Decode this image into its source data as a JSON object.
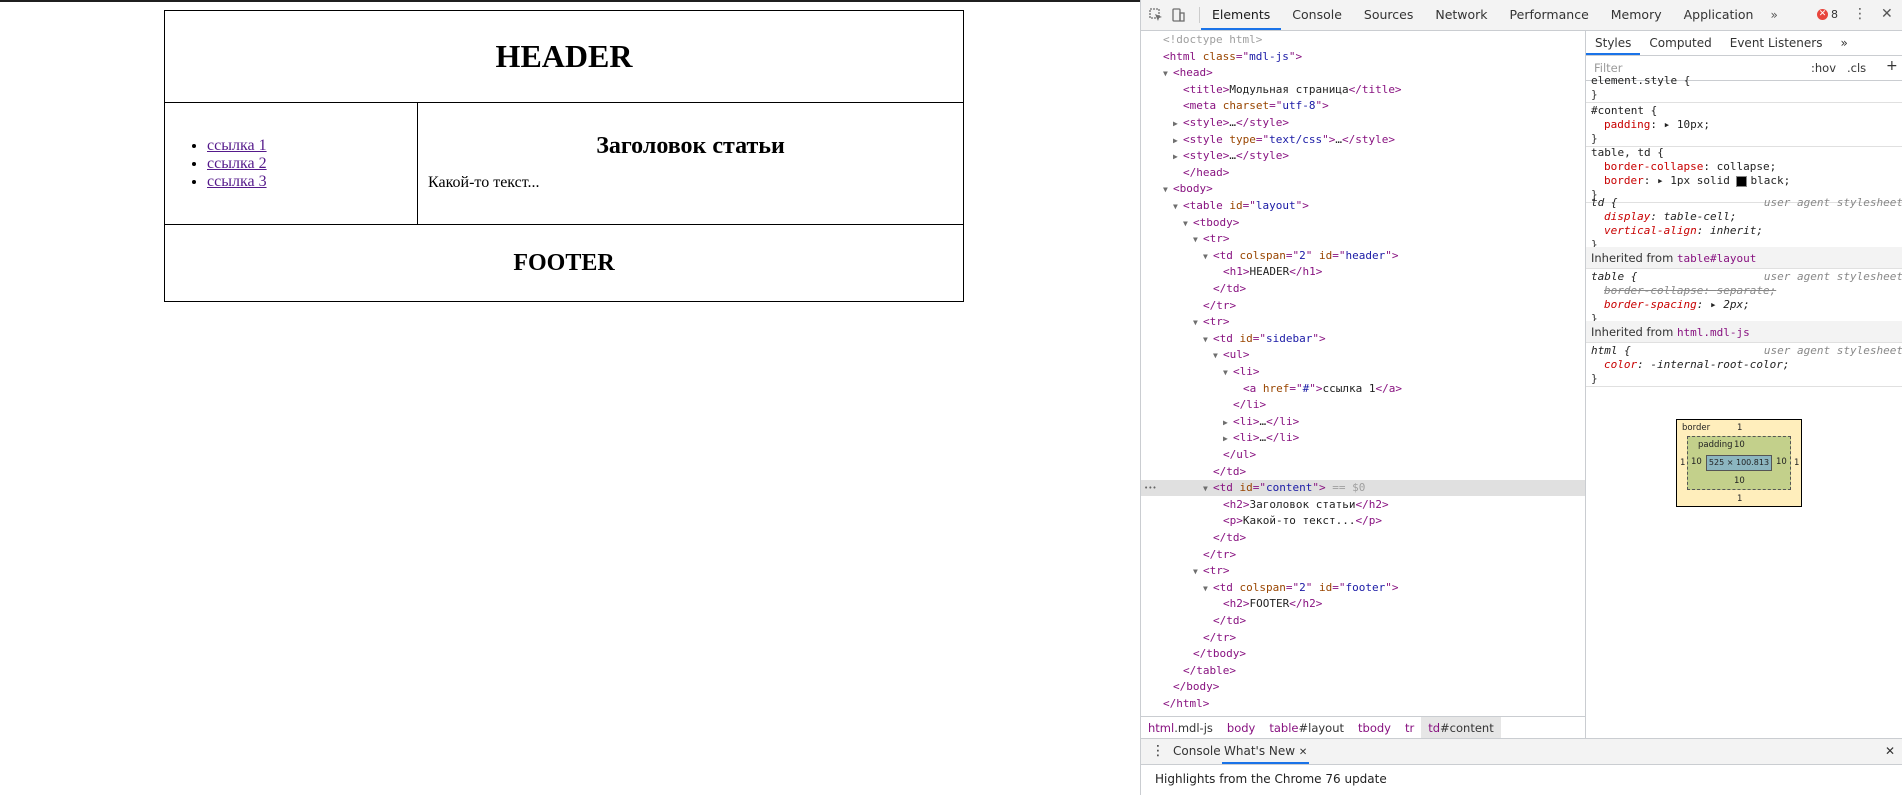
{
  "page": {
    "header": "HEADER",
    "links": [
      "ссылка 1",
      "ссылка 2",
      "ссылка 3"
    ],
    "article_title": "Заголовок статьи",
    "article_text": "Какой-то текст...",
    "footer": "FOOTER"
  },
  "devtools": {
    "tabs": [
      "Elements",
      "Console",
      "Sources",
      "Network",
      "Performance",
      "Memory",
      "Application"
    ],
    "more": "»",
    "error_count": "8",
    "breadcrumbs": [
      {
        "tag": "html",
        "id": ".mdl-js"
      },
      {
        "tag": "body",
        "id": ""
      },
      {
        "tag": "table",
        "id": "#layout"
      },
      {
        "tag": "tbody",
        "id": ""
      },
      {
        "tag": "tr",
        "id": ""
      },
      {
        "tag": "td",
        "id": "#content"
      }
    ],
    "styles_tabs": [
      "Styles",
      "Computed",
      "Event Listeners"
    ],
    "filter_placeholder": "Filter",
    "hov": ":hov",
    "cls": ".cls",
    "rules": {
      "element_style": "element.style {",
      "content_sel": "#content {",
      "content_prop": "padding",
      "content_val": "10px;",
      "table_sel": "table, td {",
      "tp1": "border-collapse",
      "tv1": "collapse;",
      "tp2": "border",
      "tv2": "1px solid ",
      "tv2b": "black;",
      "td_sel": "td {",
      "ua": "user agent stylesheet",
      "tdp1": "display",
      "tdv1": "table-cell;",
      "tdp2": "vertical-align",
      "tdv2": "inherit;",
      "inh1_label": "Inherited from ",
      "inh1_tag": "table#layout",
      "table_ua_sel": "table {",
      "tup1": "border-collapse",
      "tuv1": "separate;",
      "tup2": "border-spacing",
      "tuv2": "2px;",
      "inh2_label": "Inherited from ",
      "inh2_tag": "html.mdl-js",
      "html_sel": "html {",
      "hp1": "color",
      "hv1": "-internal-root-color;",
      "close": "}"
    },
    "box_model": {
      "border_label": "border",
      "border": "1",
      "padding_label": "padding",
      "padding": "10",
      "content": "525 × 100.813"
    },
    "drawer_tabs": [
      "Console",
      "What's New"
    ],
    "drawer_text": "Highlights from the Chrome 76 update",
    "dom_tree": [
      {
        "indent": 0,
        "tri": "",
        "html": "cm",
        "text": "<!doctype html>"
      },
      {
        "indent": 0,
        "tri": "",
        "parts": [
          [
            "tg",
            "<html "
          ],
          [
            "an",
            "class"
          ],
          [
            "tg",
            "=\""
          ],
          [
            "av",
            "mdl-js"
          ],
          [
            "tg",
            "\">"
          ]
        ]
      },
      {
        "indent": 1,
        "tri": "▼",
        "parts": [
          [
            "tg",
            "<head>"
          ]
        ]
      },
      {
        "indent": 2,
        "tri": "",
        "parts": [
          [
            "tg",
            "<title>"
          ],
          [
            "tx",
            "Модульная страница"
          ],
          [
            "tg",
            "</title>"
          ]
        ]
      },
      {
        "indent": 2,
        "tri": "",
        "parts": [
          [
            "tg",
            "<meta "
          ],
          [
            "an",
            "charset"
          ],
          [
            "tg",
            "=\""
          ],
          [
            "av",
            "utf-8"
          ],
          [
            "tg",
            "\">"
          ]
        ]
      },
      {
        "indent": 2,
        "tri": "▶",
        "parts": [
          [
            "tg",
            "<style>"
          ],
          [
            "tx",
            "…"
          ],
          [
            "tg",
            "</style>"
          ]
        ]
      },
      {
        "indent": 2,
        "tri": "▶",
        "parts": [
          [
            "tg",
            "<style "
          ],
          [
            "an",
            "type"
          ],
          [
            "tg",
            "=\""
          ],
          [
            "av",
            "text/css"
          ],
          [
            "tg",
            "\">"
          ],
          [
            "tx",
            "…"
          ],
          [
            "tg",
            "</style>"
          ]
        ]
      },
      {
        "indent": 2,
        "tri": "▶",
        "parts": [
          [
            "tg",
            "<style>"
          ],
          [
            "tx",
            "…"
          ],
          [
            "tg",
            "</style>"
          ]
        ]
      },
      {
        "indent": 2,
        "tri": "",
        "parts": [
          [
            "tg",
            "</head>"
          ]
        ]
      },
      {
        "indent": 1,
        "tri": "▼",
        "parts": [
          [
            "tg",
            "<body>"
          ]
        ]
      },
      {
        "indent": 2,
        "tri": "▼",
        "parts": [
          [
            "tg",
            "<table "
          ],
          [
            "an",
            "id"
          ],
          [
            "tg",
            "=\""
          ],
          [
            "av",
            "layout"
          ],
          [
            "tg",
            "\">"
          ]
        ]
      },
      {
        "indent": 3,
        "tri": "▼",
        "parts": [
          [
            "tg",
            "<tbody>"
          ]
        ]
      },
      {
        "indent": 4,
        "tri": "▼",
        "parts": [
          [
            "tg",
            "<tr>"
          ]
        ]
      },
      {
        "indent": 5,
        "tri": "▼",
        "parts": [
          [
            "tg",
            "<td "
          ],
          [
            "an",
            "colspan"
          ],
          [
            "tg",
            "=\""
          ],
          [
            "av",
            "2"
          ],
          [
            "tg",
            "\" "
          ],
          [
            "an",
            "id"
          ],
          [
            "tg",
            "=\""
          ],
          [
            "av",
            "header"
          ],
          [
            "tg",
            "\">"
          ]
        ]
      },
      {
        "indent": 6,
        "tri": "",
        "parts": [
          [
            "tg",
            "<h1>"
          ],
          [
            "tx",
            "HEADER"
          ],
          [
            "tg",
            "</h1>"
          ]
        ]
      },
      {
        "indent": 5,
        "tri": "",
        "parts": [
          [
            "tg",
            "</td>"
          ]
        ]
      },
      {
        "indent": 4,
        "tri": "",
        "parts": [
          [
            "tg",
            "</tr>"
          ]
        ]
      },
      {
        "indent": 4,
        "tri": "▼",
        "parts": [
          [
            "tg",
            "<tr>"
          ]
        ]
      },
      {
        "indent": 5,
        "tri": "▼",
        "parts": [
          [
            "tg",
            "<td "
          ],
          [
            "an",
            "id"
          ],
          [
            "tg",
            "=\""
          ],
          [
            "av",
            "sidebar"
          ],
          [
            "tg",
            "\">"
          ]
        ]
      },
      {
        "indent": 6,
        "tri": "▼",
        "parts": [
          [
            "tg",
            "<ul>"
          ]
        ]
      },
      {
        "indent": 7,
        "tri": "▼",
        "parts": [
          [
            "tg",
            "<li>"
          ]
        ]
      },
      {
        "indent": 8,
        "tri": "",
        "parts": [
          [
            "tg",
            "<a "
          ],
          [
            "an",
            "href"
          ],
          [
            "tg",
            "=\""
          ],
          [
            "av",
            "#"
          ],
          [
            "tg",
            "\">"
          ],
          [
            "tx",
            "ссылка 1"
          ],
          [
            "tg",
            "</a>"
          ]
        ]
      },
      {
        "indent": 7,
        "tri": "",
        "parts": [
          [
            "tg",
            "</li>"
          ]
        ]
      },
      {
        "indent": 7,
        "tri": "▶",
        "parts": [
          [
            "tg",
            "<li>"
          ],
          [
            "tx",
            "…"
          ],
          [
            "tg",
            "</li>"
          ]
        ]
      },
      {
        "indent": 7,
        "tri": "▶",
        "parts": [
          [
            "tg",
            "<li>"
          ],
          [
            "tx",
            "…"
          ],
          [
            "tg",
            "</li>"
          ]
        ]
      },
      {
        "indent": 6,
        "tri": "",
        "parts": [
          [
            "tg",
            "</ul>"
          ]
        ]
      },
      {
        "indent": 5,
        "tri": "",
        "parts": [
          [
            "tg",
            "</td>"
          ]
        ]
      },
      {
        "indent": 5,
        "tri": "▼",
        "sel": true,
        "parts": [
          [
            "tg",
            "<td "
          ],
          [
            "an",
            "id"
          ],
          [
            "tg",
            "=\""
          ],
          [
            "av",
            "content"
          ],
          [
            "tg",
            "\">"
          ],
          [
            "cm",
            " == $0"
          ]
        ]
      },
      {
        "indent": 6,
        "tri": "",
        "parts": [
          [
            "tg",
            "<h2>"
          ],
          [
            "tx",
            "Заголовок статьи"
          ],
          [
            "tg",
            "</h2>"
          ]
        ]
      },
      {
        "indent": 6,
        "tri": "",
        "parts": [
          [
            "tg",
            "<p>"
          ],
          [
            "tx",
            "Какой-то текст..."
          ],
          [
            "tg",
            "</p>"
          ]
        ]
      },
      {
        "indent": 5,
        "tri": "",
        "parts": [
          [
            "tg",
            "</td>"
          ]
        ]
      },
      {
        "indent": 4,
        "tri": "",
        "parts": [
          [
            "tg",
            "</tr>"
          ]
        ]
      },
      {
        "indent": 4,
        "tri": "▼",
        "parts": [
          [
            "tg",
            "<tr>"
          ]
        ]
      },
      {
        "indent": 5,
        "tri": "▼",
        "parts": [
          [
            "tg",
            "<td "
          ],
          [
            "an",
            "colspan"
          ],
          [
            "tg",
            "=\""
          ],
          [
            "av",
            "2"
          ],
          [
            "tg",
            "\" "
          ],
          [
            "an",
            "id"
          ],
          [
            "tg",
            "=\""
          ],
          [
            "av",
            "footer"
          ],
          [
            "tg",
            "\">"
          ]
        ]
      },
      {
        "indent": 6,
        "tri": "",
        "parts": [
          [
            "tg",
            "<h2>"
          ],
          [
            "tx",
            "FOOTER"
          ],
          [
            "tg",
            "</h2>"
          ]
        ]
      },
      {
        "indent": 5,
        "tri": "",
        "parts": [
          [
            "tg",
            "</td>"
          ]
        ]
      },
      {
        "indent": 4,
        "tri": "",
        "parts": [
          [
            "tg",
            "</tr>"
          ]
        ]
      },
      {
        "indent": 3,
        "tri": "",
        "parts": [
          [
            "tg",
            "</tbody>"
          ]
        ]
      },
      {
        "indent": 2,
        "tri": "",
        "parts": [
          [
            "tg",
            "</table>"
          ]
        ]
      },
      {
        "indent": 1,
        "tri": "",
        "parts": [
          [
            "tg",
            "</body>"
          ]
        ]
      },
      {
        "indent": 0,
        "tri": "",
        "parts": [
          [
            "tg",
            "</html>"
          ]
        ]
      }
    ]
  }
}
